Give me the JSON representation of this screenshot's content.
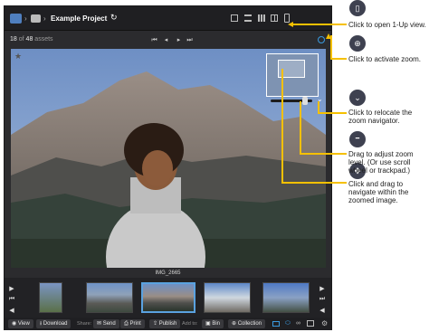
{
  "topbar": {
    "project_title": "Example Project"
  },
  "count": {
    "current": "18",
    "of": "of",
    "total": "48",
    "unit": "assets"
  },
  "filename": "IMG_2665",
  "bottom": {
    "view": "View",
    "download": "Download",
    "share_label": "Share:",
    "send": "Send",
    "print": "Print",
    "publish": "Publish",
    "add_to_label": "Add to:",
    "bin": "Bin",
    "collection": "Collection"
  },
  "annotations": [
    "Click to open 1-Up view.",
    "Click to activate zoom.",
    "Click to relocate the zoom navigator.",
    "Drag to adjust zoom level. (Or use scroll wheel or trackpad.)",
    "Click and drag to navigate within the zoomed image."
  ],
  "colors": {
    "accent": "#f5c000",
    "selection": "#5aa2e0",
    "app_bg": "#2b2b2e"
  }
}
